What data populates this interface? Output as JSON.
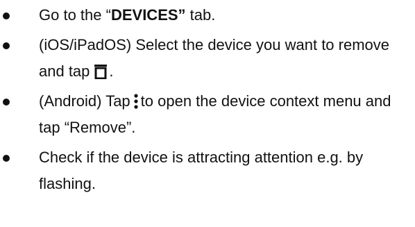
{
  "steps": [
    {
      "prefix": "Go to the “",
      "bold": "DEVICES”",
      "suffix": " tab."
    },
    {
      "text_before_icon": "(iOS/iPadOS) Select the device you want to remove and tap",
      "icon": "trash-icon",
      "text_after_icon": "."
    },
    {
      "text_before_icon": "(Android) Tap",
      "icon": "more-vertical-icon",
      "text_after_icon": "to open the device context menu and tap “Remove”."
    },
    {
      "text": "Check if the device is attracting attention e.g. by flashing."
    }
  ],
  "colors": {
    "text": "#111111",
    "background": "#ffffff"
  }
}
